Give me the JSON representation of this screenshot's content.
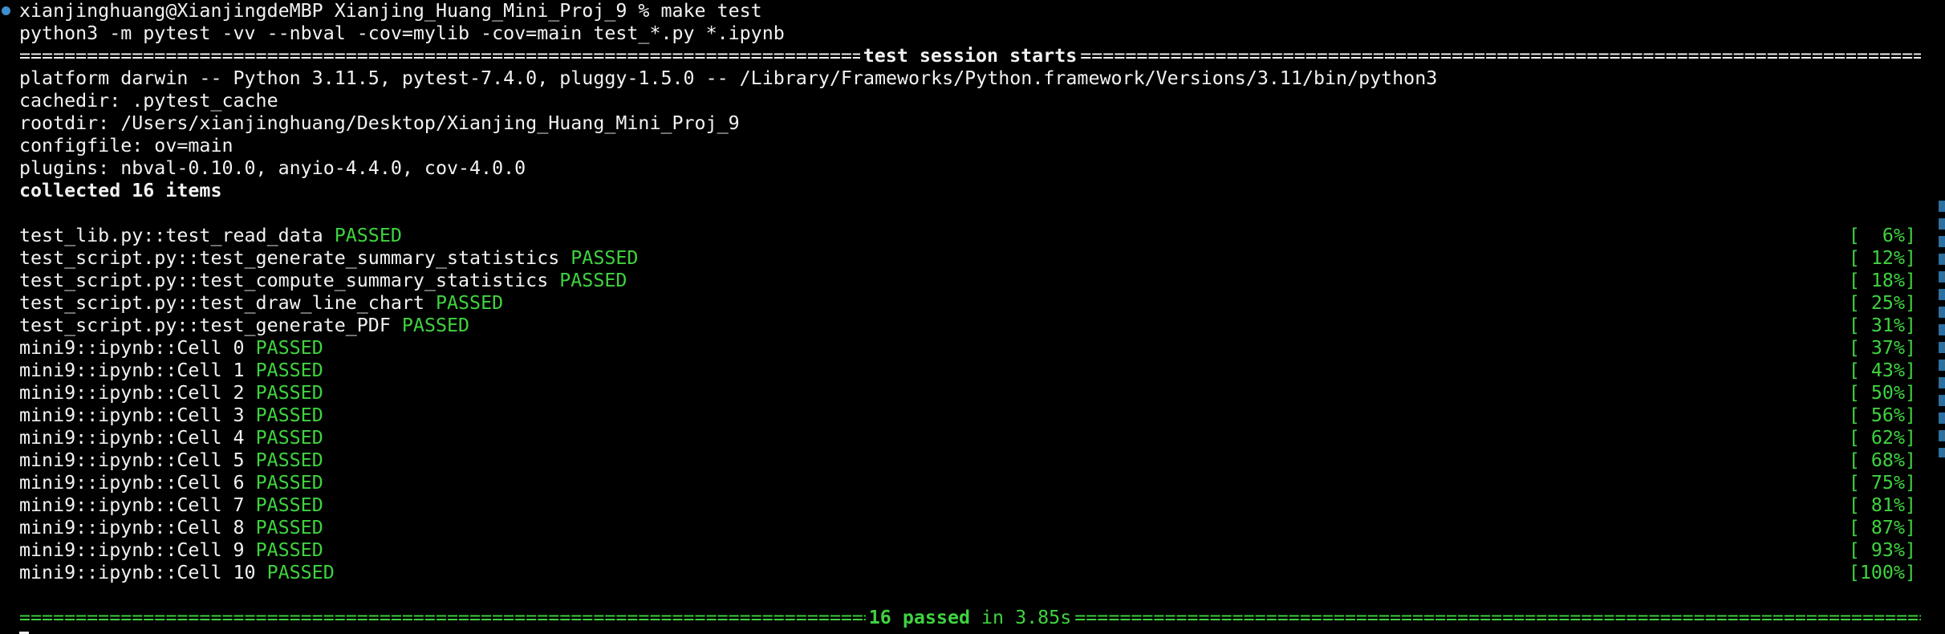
{
  "terminal": {
    "prompt_line": "xianjinghuang@XianjingdeMBP Xianjing_Huang_Mini_Proj_9 % make test",
    "command_line": "python3 -m pytest -vv --nbval -cov=mylib -cov=main test_*.py *.ipynb",
    "session_header": "test session starts",
    "session_header_fill": "========================================================================================================================",
    "platform_line": "platform darwin -- Python 3.11.5, pytest-7.4.0, pluggy-1.5.0 -- /Library/Frameworks/Python.framework/Versions/3.11/bin/python3",
    "cachedir_line": "cachedir: .pytest_cache",
    "rootdir_line": "rootdir: /Users/xianjinghuang/Desktop/Xianjing_Huang_Mini_Proj_9",
    "configfile_line": "configfile: ov=main",
    "plugins_line": "plugins: nbval-0.10.0, anyio-4.4.0, cov-4.0.0",
    "collected_line": "collected 16 items",
    "tests": [
      {
        "name": "test_lib.py::test_read_data",
        "status": "PASSED",
        "progress": "[  6%]"
      },
      {
        "name": "test_script.py::test_generate_summary_statistics",
        "status": "PASSED",
        "progress": "[ 12%]"
      },
      {
        "name": "test_script.py::test_compute_summary_statistics",
        "status": "PASSED",
        "progress": "[ 18%]"
      },
      {
        "name": "test_script.py::test_draw_line_chart",
        "status": "PASSED",
        "progress": "[ 25%]"
      },
      {
        "name": "test_script.py::test_generate_PDF",
        "status": "PASSED",
        "progress": "[ 31%]"
      },
      {
        "name": "mini9::ipynb::Cell 0",
        "status": "PASSED",
        "progress": "[ 37%]"
      },
      {
        "name": "mini9::ipynb::Cell 1",
        "status": "PASSED",
        "progress": "[ 43%]"
      },
      {
        "name": "mini9::ipynb::Cell 2",
        "status": "PASSED",
        "progress": "[ 50%]"
      },
      {
        "name": "mini9::ipynb::Cell 3",
        "status": "PASSED",
        "progress": "[ 56%]"
      },
      {
        "name": "mini9::ipynb::Cell 4",
        "status": "PASSED",
        "progress": "[ 62%]"
      },
      {
        "name": "mini9::ipynb::Cell 5",
        "status": "PASSED",
        "progress": "[ 68%]"
      },
      {
        "name": "mini9::ipynb::Cell 6",
        "status": "PASSED",
        "progress": "[ 75%]"
      },
      {
        "name": "mini9::ipynb::Cell 7",
        "status": "PASSED",
        "progress": "[ 81%]"
      },
      {
        "name": "mini9::ipynb::Cell 8",
        "status": "PASSED",
        "progress": "[ 87%]"
      },
      {
        "name": "mini9::ipynb::Cell 9",
        "status": "PASSED",
        "progress": "[ 93%]"
      },
      {
        "name": "mini9::ipynb::Cell 10",
        "status": "PASSED",
        "progress": "[100%]"
      }
    ],
    "summary_passed": "16 passed",
    "summary_time": "in 3.85s",
    "summary_fill": "========================================================================================================================",
    "colors": {
      "background": "#000000",
      "text": "#f2f2f2",
      "pass_green": "#3fd33f",
      "prompt_dot": "#3f8fd0"
    }
  }
}
